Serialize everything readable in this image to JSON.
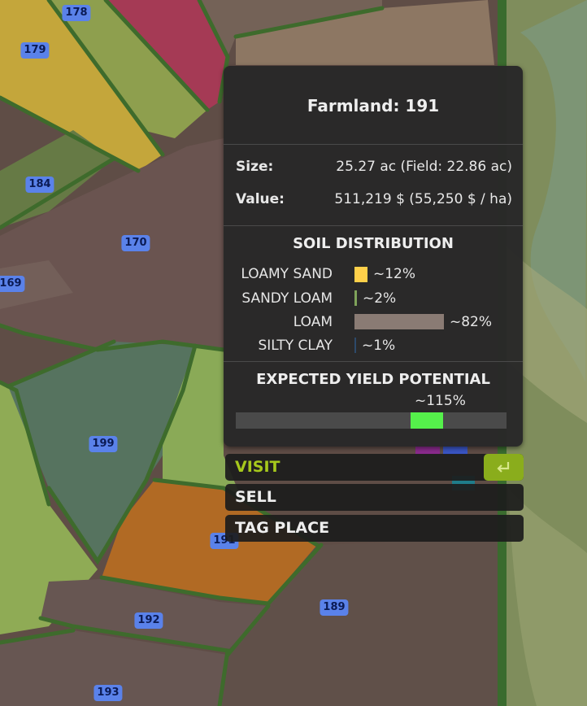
{
  "map": {
    "field_numbers": [
      "178",
      "179",
      "184",
      "170",
      "169",
      "199",
      "191",
      "192",
      "189",
      "193"
    ]
  },
  "panel": {
    "title": "Farmland: 191",
    "size_label": "Size:",
    "size_value": "25.27 ac (Field: 22.86 ac)",
    "value_label": "Value:",
    "value_value": "511,219 $ (55,250 $ / ha)",
    "soil_heading": "SOIL DISTRIBUTION",
    "soil": [
      {
        "name": "LOAMY SAND",
        "percent_text": "~12%",
        "percent": 12,
        "color": "#ffd04a"
      },
      {
        "name": "SANDY LOAM",
        "percent_text": "~2%",
        "percent": 2,
        "color": "#7fa35a"
      },
      {
        "name": "LOAM",
        "percent_text": "~82%",
        "percent": 82,
        "color": "#8a7b74"
      },
      {
        "name": "SILTY CLAY",
        "percent_text": "~1%",
        "percent": 1,
        "color": "#2d4a6a"
      }
    ],
    "yield_heading": "EXPECTED YIELD POTENTIAL",
    "yield_text": "~115%",
    "yield_value": 115,
    "yield_color": "#55f04b"
  },
  "actions": {
    "visit": "VISIT",
    "sell": "SELL",
    "tag_place": "TAG PLACE",
    "visit_key_icon": "enter-key-icon",
    "accent_color": "#a6c81c"
  }
}
